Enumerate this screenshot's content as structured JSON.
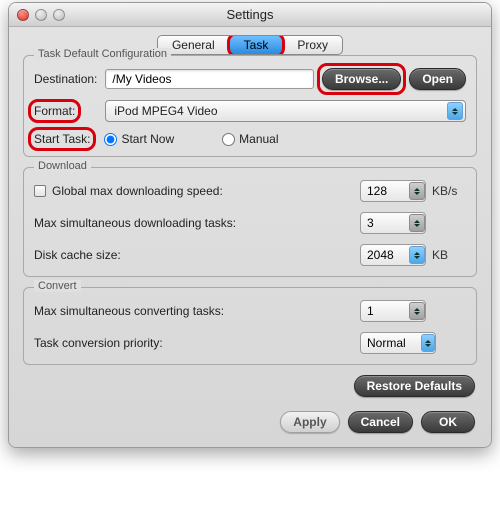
{
  "window": {
    "title": "Settings"
  },
  "tabs": {
    "general": "General",
    "task": "Task",
    "proxy": "Proxy"
  },
  "taskDefault": {
    "legend": "Task Default Configuration",
    "destination_label": "Destination:",
    "destination_value": "/My Videos",
    "browse": "Browse...",
    "open": "Open",
    "format_label": "Format:",
    "format_value": "iPod MPEG4 Video",
    "start_label": "Start Task:",
    "start_now": "Start Now",
    "manual": "Manual"
  },
  "download": {
    "legend": "Download",
    "global_max_label": "Global max downloading speed:",
    "global_max_value": "128",
    "kbps": "KB/s",
    "max_tasks_label": "Max simultaneous downloading tasks:",
    "max_tasks_value": "3",
    "cache_label": "Disk cache size:",
    "cache_value": "2048",
    "kb": "KB"
  },
  "convert": {
    "legend": "Convert",
    "max_tasks_label": "Max simultaneous converting tasks:",
    "max_tasks_value": "1",
    "priority_label": "Task conversion priority:",
    "priority_value": "Normal"
  },
  "buttons": {
    "restore": "Restore Defaults",
    "apply": "Apply",
    "cancel": "Cancel",
    "ok": "OK"
  }
}
